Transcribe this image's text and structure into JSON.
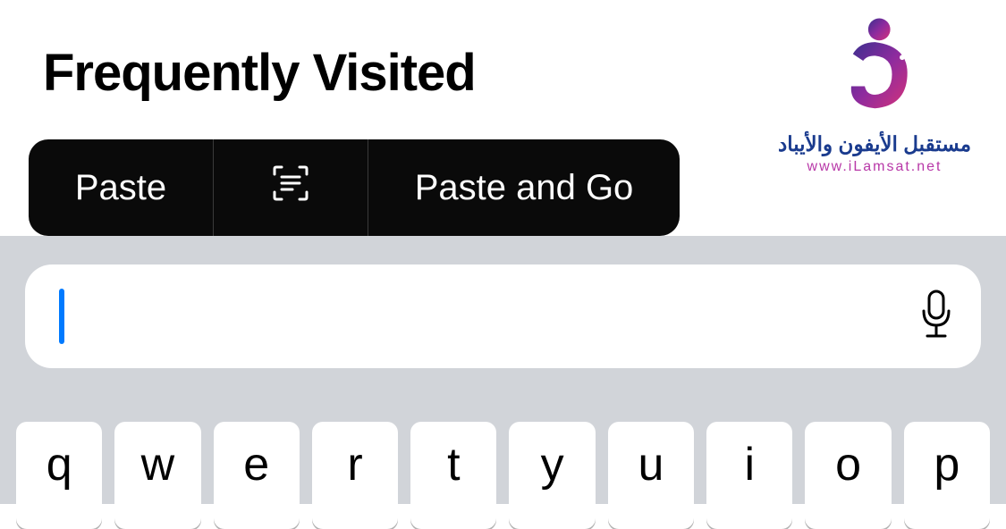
{
  "header": {
    "title": "Frequently Visited"
  },
  "context_menu": {
    "paste_label": "Paste",
    "paste_go_label": "Paste and Go"
  },
  "address_bar": {
    "value": ""
  },
  "watermark": {
    "arabic_text": "مستقبل الأيفون والأيباد",
    "url_text": "www.iLamsat.net"
  },
  "keyboard": {
    "row1": [
      "q",
      "w",
      "e",
      "r",
      "t",
      "y",
      "u",
      "i",
      "o",
      "p"
    ]
  }
}
